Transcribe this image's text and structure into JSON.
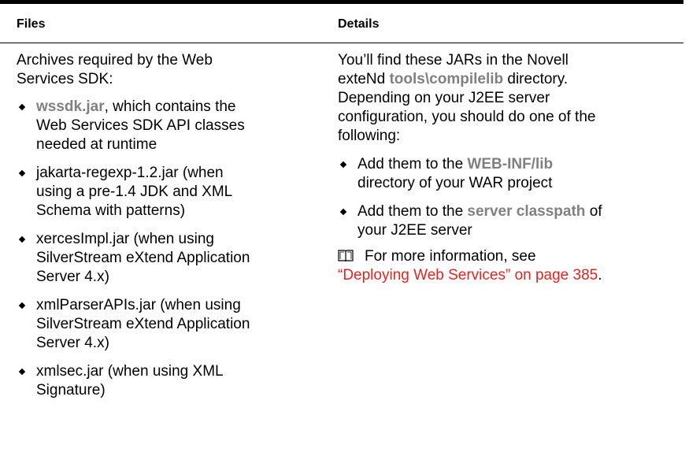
{
  "headers": {
    "files": "Files",
    "details": "Details"
  },
  "left": {
    "intro": [
      "Archives required by the Web",
      "Services SDK:"
    ],
    "items": [
      {
        "lead_bold": "wssdk.jar",
        "lines": [
          ", which contains the",
          "Web Services SDK API classes",
          "needed at runtime"
        ]
      },
      {
        "lines": [
          "jakarta-regexp-1.2.jar (when",
          "using a pre-1.4 JDK and XML",
          "Schema with patterns)"
        ]
      },
      {
        "lines": [
          "xercesImpl.jar (when using",
          "SilverStream eXtend Application",
          "Server 4.x)"
        ]
      },
      {
        "lines": [
          "xmlParserAPIs.jar (when using",
          "SilverStream eXtend Application",
          "Server 4.x)"
        ]
      },
      {
        "lines": [
          "xmlsec.jar (when using XML",
          "Signature)"
        ]
      }
    ]
  },
  "right": {
    "intro_line1": "You’ll find these JARs in the Novell",
    "intro_line2_prefix": "exteNd ",
    "intro_line2_code": "tools\\compilelib",
    "intro_line2_suffix": " directory.",
    "intro_rest": [
      "Depending on your J2EE server",
      "configuration, you should do one of the",
      "following:"
    ],
    "items": [
      {
        "prefix": "Add them to the ",
        "code": "WEB-INF/lib",
        "line2": "directory of your WAR project"
      },
      {
        "prefix": "Add them to the ",
        "code": "server classpath",
        "suffix": " of",
        "line2": "your J2EE server"
      }
    ],
    "more_text": "For more information, see",
    "more_link": "“Deploying Web Services” on page 385",
    "more_end": "."
  }
}
